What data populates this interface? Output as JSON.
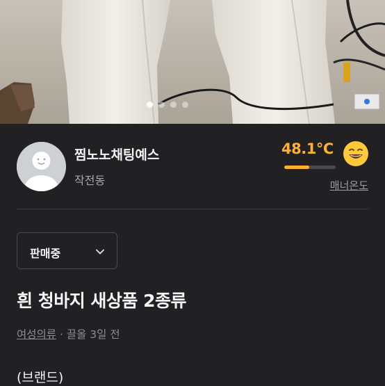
{
  "carousel": {
    "total": 4,
    "active_index": 0
  },
  "seller": {
    "name": "찜노노채팅예스",
    "location": "작전동",
    "temperature": "48.1°C",
    "temperature_level": 0.481,
    "manner_label": "매너온도"
  },
  "status": {
    "selected": "판매중"
  },
  "product": {
    "title": "흰 청바지 새상품 2종류",
    "category": "여성의류",
    "separator": " · ",
    "bumped": "끌올 3일 전",
    "description_first_line": "(브랜드)"
  },
  "colors": {
    "background": "#212123",
    "accent": "#ffb02e"
  },
  "icons": [
    "default-avatar-icon",
    "smiley-emoji-icon",
    "chevron-down-icon"
  ]
}
